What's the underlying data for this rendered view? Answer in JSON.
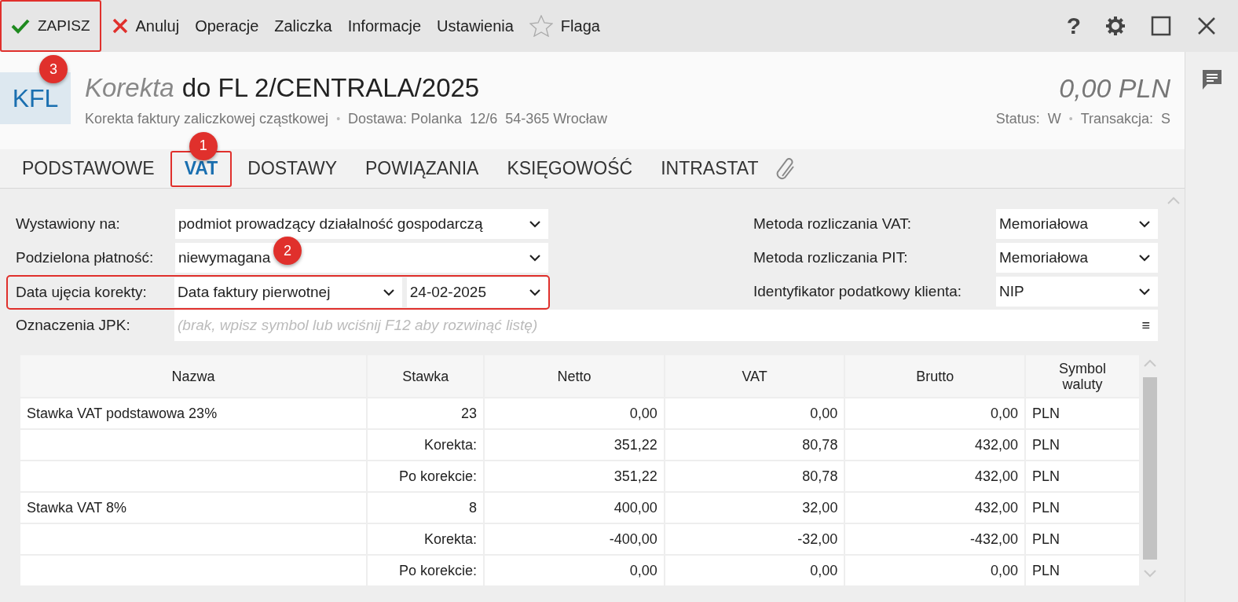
{
  "toolbar": {
    "items": [
      {
        "kind": "save",
        "label": "ZAPISZ",
        "callout": "3"
      },
      {
        "kind": "cancel",
        "label": "Anuluj"
      },
      {
        "kind": "plain",
        "label": "Operacje"
      },
      {
        "kind": "plain",
        "label": "Zaliczka"
      },
      {
        "kind": "plain",
        "label": "Informacje"
      },
      {
        "kind": "plain",
        "label": "Ustawienia"
      },
      {
        "kind": "flag",
        "label": "Flaga"
      }
    ],
    "help": "?"
  },
  "header": {
    "badge": "KFL",
    "title_prefix": "Korekta",
    "title": "do FL 2/CENTRALA/2025",
    "subtitle": [
      "Korekta faktury zaliczkowej cząstkowej",
      "Dostawa: Polanka  12/6  54-365 Wrocław"
    ],
    "separator": "•",
    "amount": "0,00 PLN",
    "meta": [
      "Status:  W",
      "Transakcja:  S"
    ]
  },
  "tabs": [
    {
      "label": "PODSTAWOWE",
      "selected": false
    },
    {
      "label": "VAT",
      "selected": true,
      "callout": "1"
    },
    {
      "label": "DOSTAWY",
      "selected": false
    },
    {
      "label": "POWIĄZANIA",
      "selected": false
    },
    {
      "label": "KSIĘGOWOŚĆ",
      "selected": false
    },
    {
      "label": "INTRASTAT",
      "selected": false
    }
  ],
  "form_left": [
    {
      "label": "Wystawiony na:",
      "values": [
        "podmiot prowadzący działalność gospodarczą"
      ]
    },
    {
      "label": "Podzielona płatność:",
      "values": [
        "niewymagana"
      ],
      "callout": "2"
    },
    {
      "label": "Data ujęcia korekty:",
      "values": [
        "Data faktury pierwotnej",
        "24-02-2025"
      ],
      "outlined": true
    }
  ],
  "form_right": [
    {
      "label": "Metoda rozliczania VAT:",
      "value": "Memoriałowa"
    },
    {
      "label": "Metoda rozliczania PIT:",
      "value": "Memoriałowa"
    },
    {
      "label": "Identyfikator podatkowy klienta:",
      "value": "NIP"
    }
  ],
  "jpk": {
    "label": "Oznaczenia JPK:",
    "placeholder": "(brak, wpisz symbol lub wciśnij F12 aby rozwinąć listę)",
    "button": "≡"
  },
  "table": {
    "columns": [
      "Nazwa",
      "Stawka",
      "Netto",
      "VAT",
      "Brutto",
      "Symbol waluty"
    ],
    "rows": [
      {
        "nazwa": "Stawka VAT podstawowa 23%",
        "stawka": "23",
        "netto": "0,00",
        "vat": "0,00",
        "brutto": "0,00",
        "waluta": "PLN"
      },
      {
        "stawka": "Korekta:",
        "netto": "351,22",
        "vat": "80,78",
        "brutto": "432,00",
        "waluta": "PLN"
      },
      {
        "stawka": "Po korekcie:",
        "netto": "351,22",
        "vat": "80,78",
        "brutto": "432,00",
        "waluta": "PLN"
      },
      {
        "nazwa": "Stawka VAT 8%",
        "stawka": "8",
        "netto": "400,00",
        "vat": "32,00",
        "brutto": "432,00",
        "waluta": "PLN"
      },
      {
        "stawka": "Korekta:",
        "netto": "-400,00",
        "vat": "-32,00",
        "brutto": "-432,00",
        "waluta": "PLN"
      },
      {
        "stawka": "Po korekcie:",
        "netto": "0,00",
        "vat": "0,00",
        "brutto": "0,00",
        "waluta": "PLN"
      }
    ]
  }
}
